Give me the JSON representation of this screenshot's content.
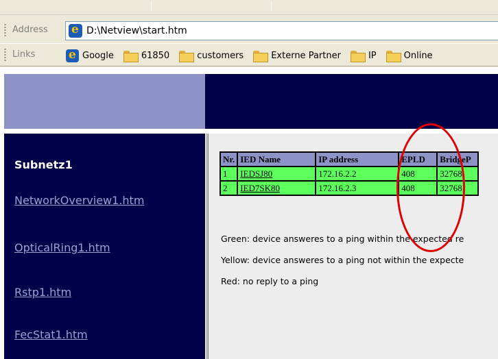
{
  "browser": {
    "address_label": "Address",
    "address_value": "D:\\Netview\\start.htm",
    "links_label": "Links",
    "links": [
      {
        "label": "Google",
        "icon": "ie-page-icon"
      },
      {
        "label": "61850",
        "icon": "folder-icon"
      },
      {
        "label": "customers",
        "icon": "folder-icon"
      },
      {
        "label": "Externe Partner",
        "icon": "folder-icon"
      },
      {
        "label": "IP",
        "icon": "folder-icon"
      },
      {
        "label": "Online",
        "icon": "folder-icon"
      }
    ]
  },
  "nav": {
    "title": "Subnetz1",
    "links": [
      "NetworkOverview1.htm",
      "OpticalRing1.htm",
      "Rstp1.htm",
      "FecStat1.htm"
    ]
  },
  "table": {
    "headers": [
      "Nr.",
      "IED Name",
      "IP address",
      "EPLD",
      "BridgeP"
    ],
    "rows": [
      [
        "1",
        "IEDSJ80",
        "172.16.2.2",
        "408",
        "32768"
      ],
      [
        "2",
        "IED7SK80",
        "172.16.2.3",
        "408",
        "32768"
      ]
    ]
  },
  "legend": [
    "Green: device answeres to a ping within the expected re",
    "Yellow: device answeres to a ping not within the expecte",
    "Red: no reply to a ping"
  ],
  "colors": {
    "header_bg": "#8d93c7",
    "row_ok": "#5cff5c",
    "nav_bg": "#000048",
    "annotation": "#e00000"
  }
}
